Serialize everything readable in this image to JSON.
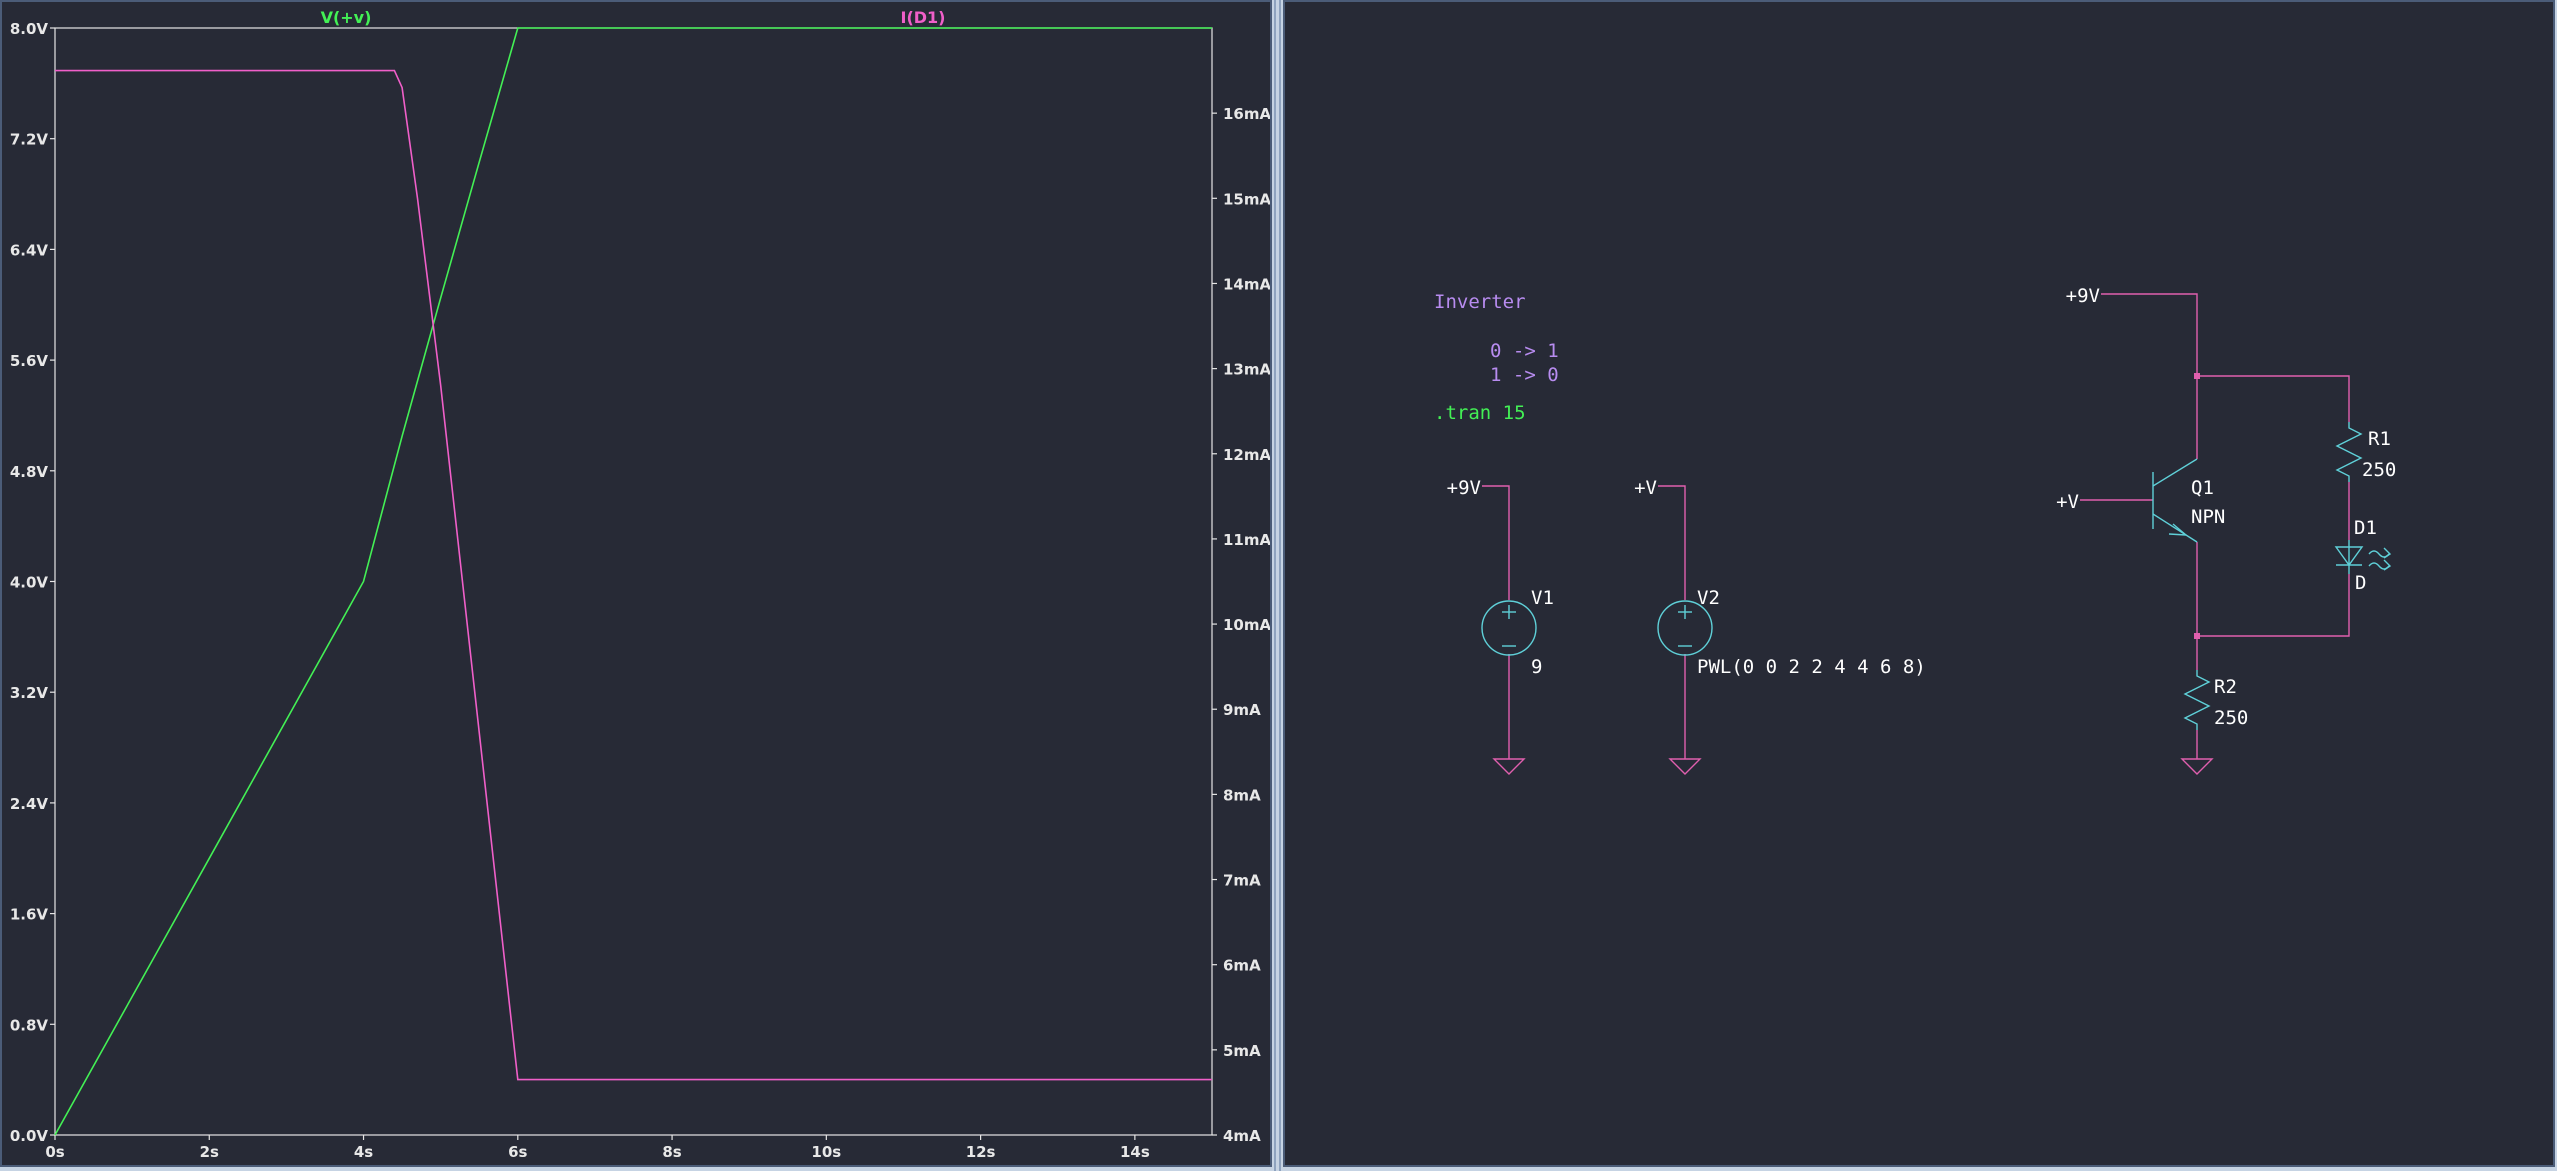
{
  "plot": {
    "trace_labels": [
      {
        "text": "V(+v)",
        "color": "#43f055"
      },
      {
        "text": "I(D1)",
        "color": "#f05fc9"
      }
    ]
  },
  "chart_data": {
    "type": "line",
    "xlabel": "",
    "ylabel": "",
    "x_ticks": [
      "0s",
      "2s",
      "4s",
      "6s",
      "8s",
      "10s",
      "12s",
      "14s"
    ],
    "y_left_ticks": [
      "0.0V",
      "0.8V",
      "1.6V",
      "2.4V",
      "3.2V",
      "4.0V",
      "4.8V",
      "5.6V",
      "6.4V",
      "7.2V",
      "8.0V"
    ],
    "y_right_ticks": [
      "4mA",
      "5mA",
      "6mA",
      "7mA",
      "8mA",
      "9mA",
      "10mA",
      "11mA",
      "12mA",
      "13mA",
      "14mA",
      "15mA",
      "16mA"
    ],
    "xlim": [
      0,
      15
    ],
    "ylim_left": [
      0,
      8
    ],
    "ylim_right": [
      4,
      17
    ],
    "grid": false,
    "series": [
      {
        "name": "V(+v)",
        "axis": "left",
        "color": "#43f055",
        "x": [
          0,
          2,
          4,
          4.5,
          5,
          5.5,
          6,
          15
        ],
        "y": [
          0,
          2,
          4,
          5.05,
          6.05,
          7.03,
          8,
          8
        ]
      },
      {
        "name": "I(D1)",
        "axis": "right",
        "color": "#f05fc9",
        "x": [
          0,
          4.4,
          4.5,
          4.7,
          5,
          6,
          15
        ],
        "y": [
          16.5,
          16.5,
          16.3,
          15.0,
          12.8,
          4.65,
          4.65
        ]
      }
    ]
  },
  "schematic": {
    "comment": "Inverter",
    "truth_lines": [
      "0 -> 1",
      "1 -> 0"
    ],
    "directive": ".tran 15",
    "colors": {
      "wire": "#e05fae",
      "component": "#5fd0d8",
      "text": "#ffffff",
      "comment": "#b88cf0",
      "directive": "#43f055",
      "junction": "#e05fae"
    },
    "v1": {
      "net": "+9V",
      "name": "V1",
      "value": "9"
    },
    "v2": {
      "net": "+V",
      "name": "V2",
      "value": "PWL(0 0 2 2 4 4 6 8)"
    },
    "collector_net": "+9V",
    "base_net": "+V",
    "q1": {
      "name": "Q1",
      "model": "NPN"
    },
    "r1": {
      "name": "R1",
      "value": "250"
    },
    "d1": {
      "name": "D1",
      "model": "D"
    },
    "r2": {
      "name": "R2",
      "value": "250"
    }
  }
}
